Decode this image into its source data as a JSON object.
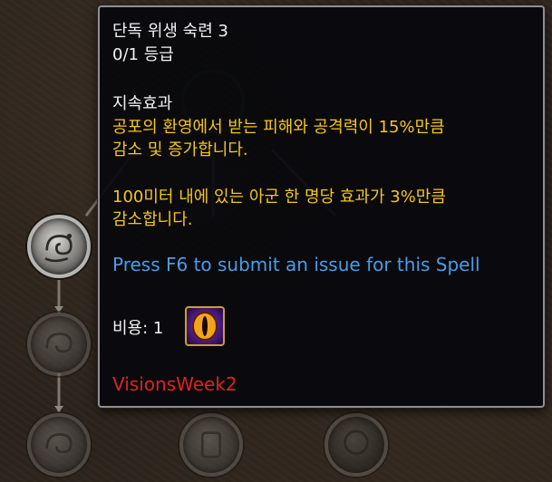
{
  "tooltip": {
    "title": "단독 위생 숙련 3",
    "rank": "0/1 등급",
    "section_header": "지속효과",
    "effect_line1": "공포의 환영에서 받는 피해와 공격력이 15%만큼",
    "effect_line2": "감소 및 증가합니다.",
    "effect2_line1": "100미터 내에 있는 아군 한 명당 효과가 3%만큼",
    "effect2_line2": "감소합니다.",
    "report_hint": "Press F6 to submit an issue for this Spell",
    "cost_label": "비용: 1",
    "cost_icon": "eye-icon",
    "tag": "VisionsWeek2"
  },
  "colors": {
    "title": "#f2f2f2",
    "effect": "#f3c61f",
    "hint": "#4a9de6",
    "tag": "#dd2323",
    "border": "#8f8f93"
  },
  "talent_tree": {
    "nodes": [
      {
        "icon": "swirl-icon",
        "state": "active"
      },
      {
        "icon": "swirl-icon",
        "state": "locked"
      },
      {
        "icon": "swirl-icon",
        "state": "locked"
      },
      {
        "icon": "rune-icon",
        "state": "locked"
      },
      {
        "icon": "skull-icon",
        "state": "locked"
      },
      {
        "icon": "skull-icon",
        "state": "locked"
      },
      {
        "icon": "skull-icon",
        "state": "locked"
      }
    ]
  }
}
